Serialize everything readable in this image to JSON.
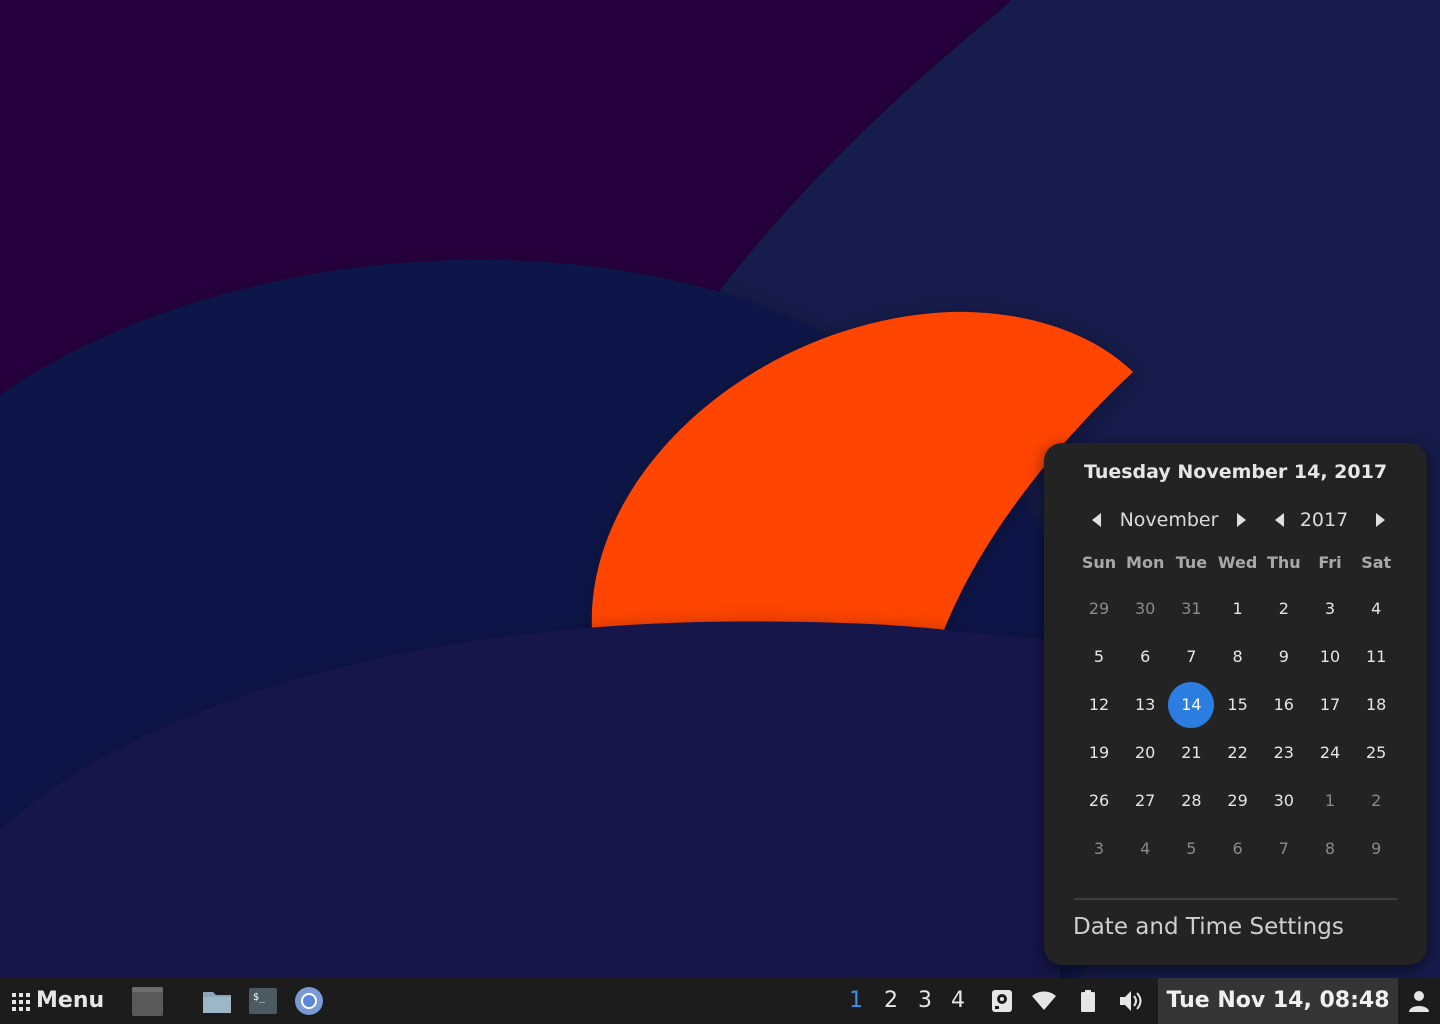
{
  "colors": {
    "wallpaper_top": "#27003f",
    "wallpaper_blue": "#141548",
    "wallpaper_orange": "#ff4400",
    "accent": "#2b7de0",
    "popover_bg": "#232323",
    "panel_bg": "#1c1c1c"
  },
  "calendar": {
    "heading": "Tuesday November 14, 2017",
    "month_label": "November",
    "year_label": "2017",
    "weekdays": [
      "Sun",
      "Mon",
      "Tue",
      "Wed",
      "Thu",
      "Fri",
      "Sat"
    ],
    "weeks": [
      [
        "29",
        "30",
        "31",
        "1",
        "2",
        "3",
        "4"
      ],
      [
        "5",
        "6",
        "7",
        "8",
        "9",
        "10",
        "11"
      ],
      [
        "12",
        "13",
        "14",
        "15",
        "16",
        "17",
        "18"
      ],
      [
        "19",
        "20",
        "21",
        "22",
        "23",
        "24",
        "25"
      ],
      [
        "26",
        "27",
        "28",
        "29",
        "30",
        "1",
        "2"
      ],
      [
        "3",
        "4",
        "5",
        "6",
        "7",
        "8",
        "9"
      ]
    ],
    "selected_day": "14",
    "settings_label": "Date and Time Settings"
  },
  "panel": {
    "menu_label": "Menu",
    "launchers": [
      "files-icon",
      "terminal-icon",
      "chromium-icon"
    ],
    "workspaces": [
      "1",
      "2",
      "3",
      "4"
    ],
    "active_workspace": "1",
    "tray_icons": [
      "disk-icon",
      "wifi-icon",
      "battery-icon",
      "volume-icon"
    ],
    "clock": "Tue Nov 14, 08:48"
  }
}
